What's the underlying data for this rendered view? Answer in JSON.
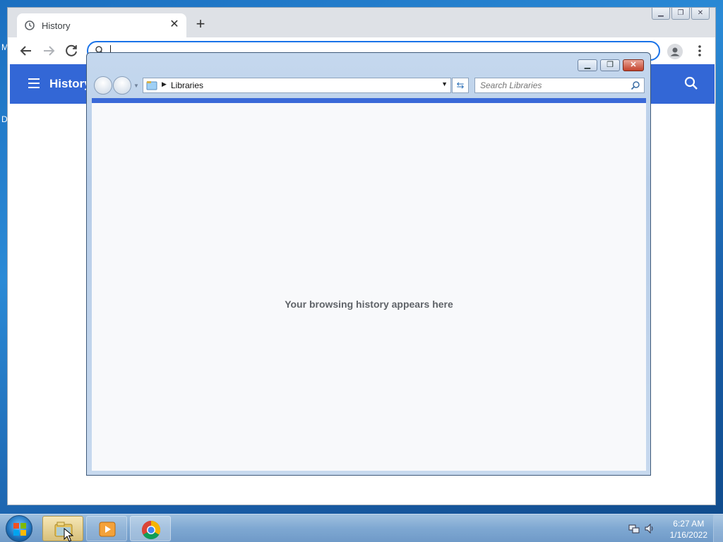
{
  "desktop": {
    "left_edge_text_1": "M",
    "left_edge_text_2": "D"
  },
  "chrome": {
    "tab_title": "History",
    "tab_icon": "history-clock-icon",
    "close_tab_glyph": "✕",
    "new_tab_glyph": "+",
    "window_controls": [
      "minimize",
      "maximize",
      "close"
    ],
    "toolbar": {
      "back_icon": "arrow-left-icon",
      "forward_icon": "arrow-right-icon",
      "reload_icon": "reload-icon",
      "omnibox_value": "",
      "profile_icon": "person-icon",
      "menu_icon": "vertical-dots-icon"
    },
    "history_header": {
      "title": "History",
      "menu_icon": "hamburger-icon",
      "search_icon": "search-icon"
    },
    "accent_color": "#3367d6"
  },
  "explorer": {
    "address_path": "Libraries",
    "search_placeholder": "Search Libraries",
    "empty_message": "Your browsing history appears here",
    "controls": [
      "minimize",
      "maximize",
      "close"
    ]
  },
  "taskbar": {
    "apps": [
      {
        "name": "Windows Explorer",
        "icon": "folder-icon",
        "active": true
      },
      {
        "name": "Windows Media Player",
        "icon": "media-player-icon",
        "active": false
      },
      {
        "name": "Google Chrome",
        "icon": "chrome-icon",
        "active": true
      }
    ],
    "clock_time": "6:27 AM",
    "clock_date": "1/16/2022"
  }
}
